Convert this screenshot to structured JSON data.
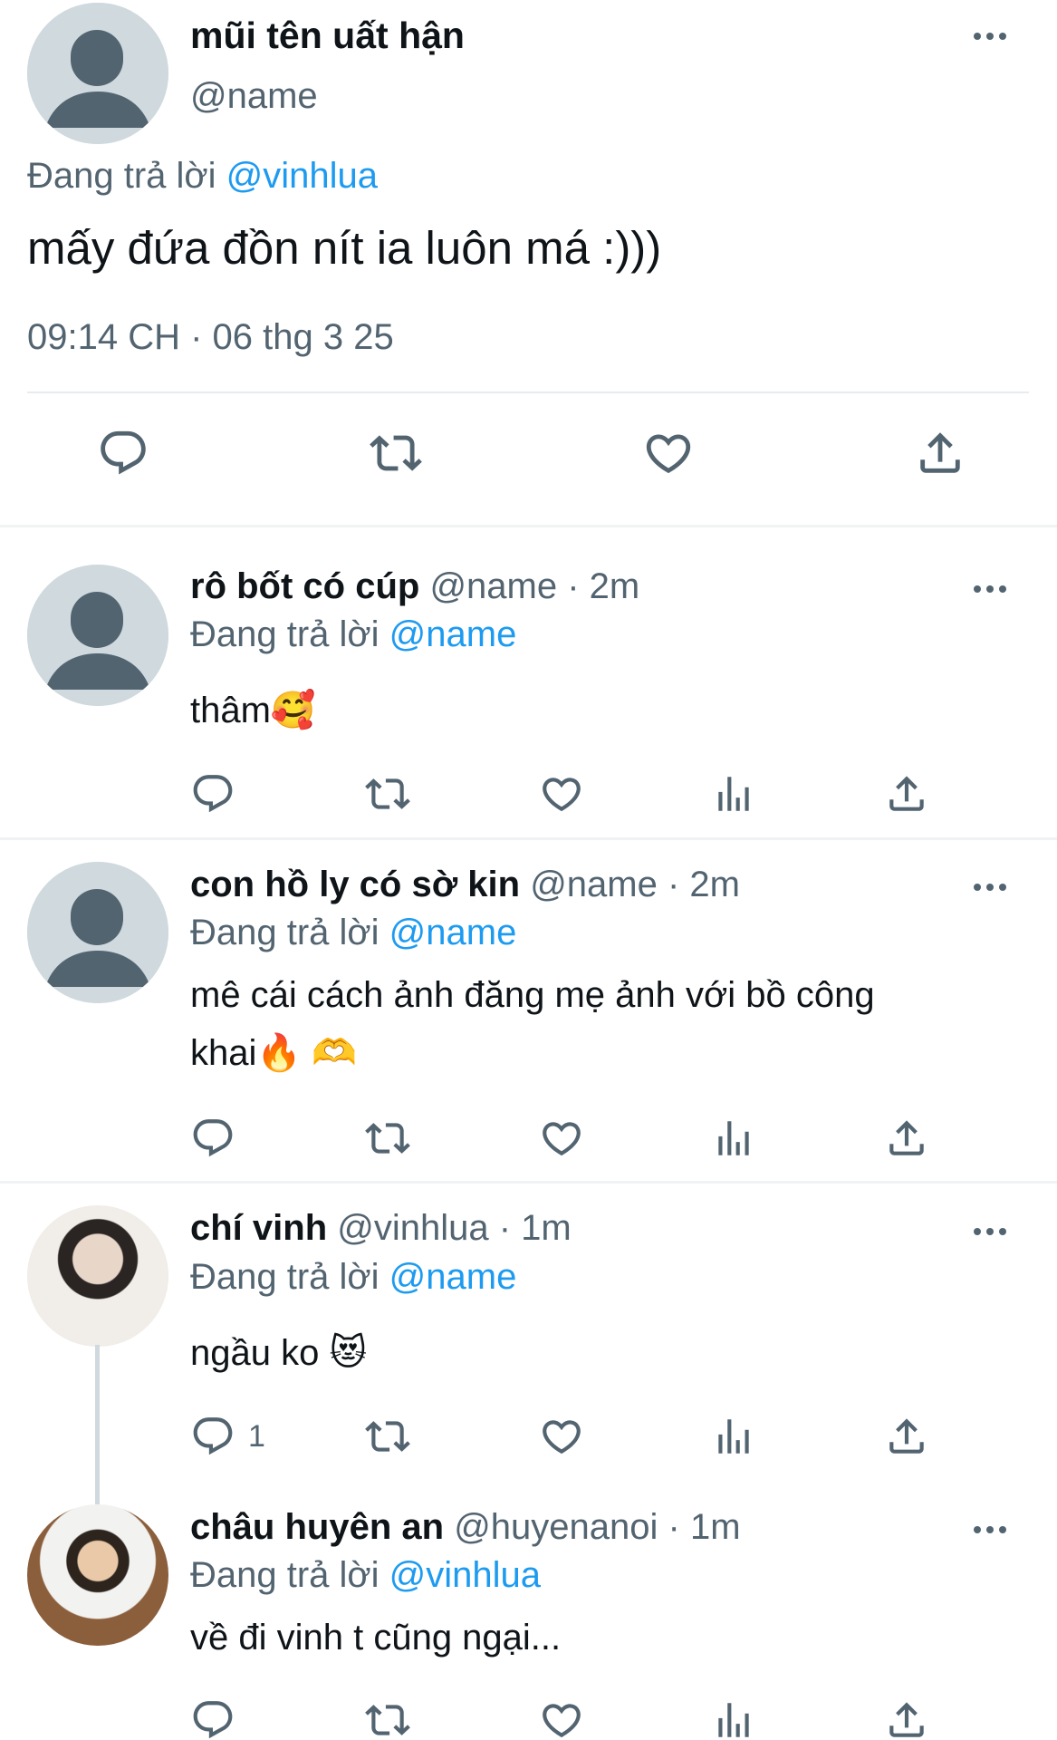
{
  "main_tweet": {
    "display_name": "mũi tên uất hận",
    "handle": "@name",
    "replying_prefix": "Đang trả lời",
    "replying_to": "@vinhlua",
    "text": "mấy đứa đồn nít ia luôn má :)))",
    "timestamp": "09:14 CH · 06 thg 3 25"
  },
  "replies": [
    {
      "display_name": "rô bốt có cúp",
      "meta": "@name · 2m",
      "replying_prefix": "Đang trả lời",
      "replying_to": "@name",
      "text": "thâm🥰",
      "reply_count": ""
    },
    {
      "display_name": "con hồ ly có sờ kin",
      "meta": "@name · 2m",
      "replying_prefix": "Đang trả lời",
      "replying_to": "@name",
      "text_line1": "mê cái cách ảnh đăng mẹ ảnh với bồ công",
      "text_line2": "khai🔥 🫶",
      "reply_count": ""
    },
    {
      "display_name": "chí vinh",
      "meta": "@vinhlua · 1m",
      "replying_prefix": "Đang trả lời",
      "replying_to": "@name",
      "text": "ngầu ko 😻",
      "reply_count": "1"
    },
    {
      "display_name": "châu huyên an",
      "meta": "@huyenanoi · 1m",
      "replying_prefix": "Đang trả lời",
      "replying_to": "@vinhlua",
      "text": "về đi vinh t cũng ngại...",
      "reply_count": ""
    }
  ],
  "icons": {
    "reply": "reply-icon",
    "retweet": "retweet-icon",
    "like": "like-icon",
    "views": "views-icon",
    "share": "share-icon",
    "more": "more-icon"
  },
  "colors": {
    "link": "#1d9bf0",
    "secondary_text": "#536471",
    "primary_text": "#0f1419",
    "divider": "#eff3f4"
  }
}
